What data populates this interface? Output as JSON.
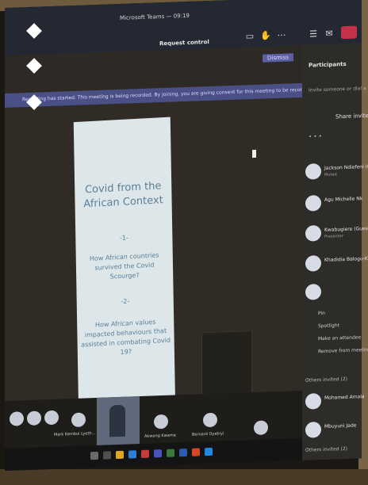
{
  "window": {
    "title": "Microsoft Teams — 09:19",
    "status": "Request control"
  },
  "notification": {
    "text": "Recording has started. This meeting is being recorded. By joining, you are giving consent for this meeting to be recorded. Privacy policy",
    "dismiss_label": "Dismiss"
  },
  "slide": {
    "title": "Covid from the African Context",
    "num1": "-1-",
    "point1": "How African countries survived the Covid Scourge?",
    "num2": "-2-",
    "point2": "How African values impacted behaviours that assisted in combating Covid 19?"
  },
  "participants": {
    "title": "Participants",
    "invite_placeholder": "Invite someone or dial a number",
    "share_invite": "Share invite",
    "people": [
      {
        "name": "Jackson Ndiefeni (Guest)",
        "sub": "Muted"
      },
      {
        "name": "Agu Michelle Nk",
        "sub": ""
      },
      {
        "name": "Kwabugiere (Guest)",
        "sub": "Presenter"
      },
      {
        "name": "Khadidia Balogu-Kun",
        "sub": ""
      }
    ],
    "menu": [
      "Pin",
      "Spotlight",
      "Make an attendee",
      "Remove from meeting"
    ],
    "section_others": "Others invited (2)",
    "others": [
      {
        "name": "Mohamed Amala",
        "sub": ""
      },
      {
        "name": "Mbuyuni Jade",
        "sub": ""
      }
    ],
    "section_guests": "Others invited (2)"
  },
  "strip": {
    "labels": [
      "Mark Kemboi Lyeth...",
      "Akwang Kwame",
      "Bernard Oyebiyi"
    ]
  }
}
